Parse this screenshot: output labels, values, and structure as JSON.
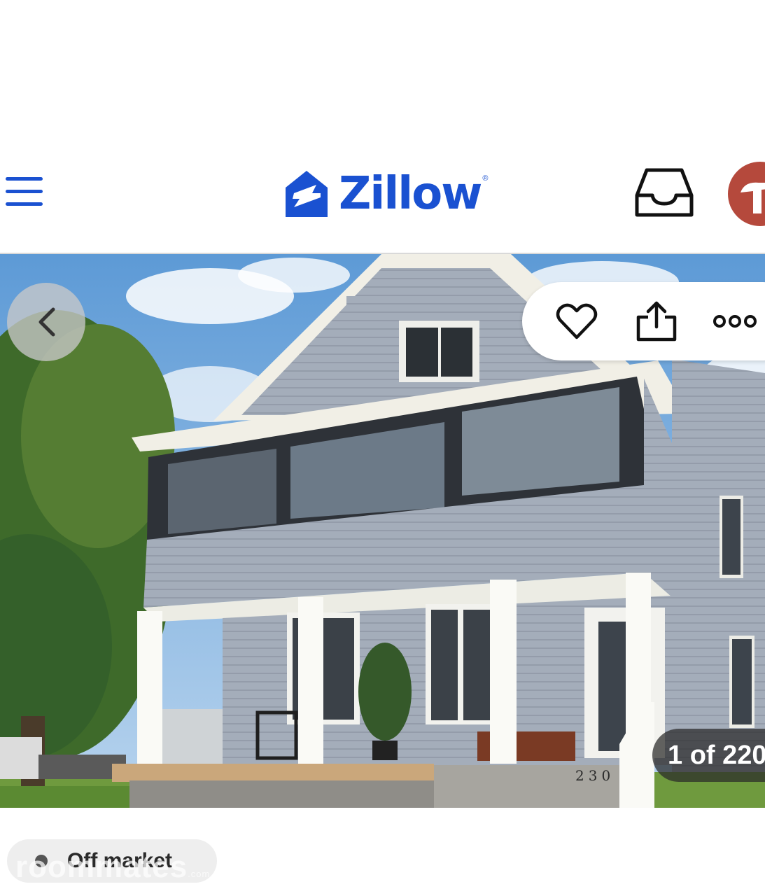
{
  "header": {
    "brand_name": "Zillow",
    "brand_mark": "®",
    "brand_color": "#1a51d1",
    "menu_icon": "hamburger-menu-icon",
    "inbox_icon": "inbox-tray-icon"
  },
  "photo": {
    "house_number": "230",
    "counter": "1 of 220",
    "back_icon": "chevron-left-icon",
    "actions": {
      "save_icon": "heart-icon",
      "share_icon": "share-icon",
      "more_icon": "more-dots-icon"
    }
  },
  "listing": {
    "status_label": "Off market",
    "status_color": "#555555"
  },
  "watermark": {
    "text": "roommates",
    "suffix": ".com"
  }
}
